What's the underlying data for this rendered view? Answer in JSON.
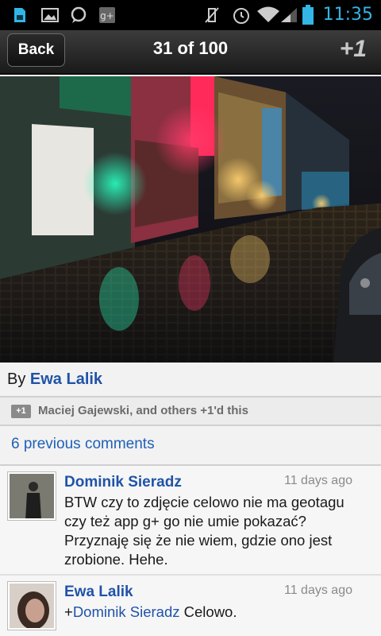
{
  "status_bar": {
    "time": "11:35",
    "icons": [
      "sim-card-icon",
      "gallery-icon",
      "talk-icon",
      "google-plus-icon",
      "vibrate-muted-icon",
      "alarm-icon",
      "wifi-icon",
      "signal-icon",
      "battery-icon"
    ],
    "time_color": "#33b5e5"
  },
  "header": {
    "back_label": "Back",
    "counter": "31 of 100",
    "plus_one_label": "+1"
  },
  "photo": {
    "description_icon": "photo-night-street"
  },
  "post": {
    "by_prefix": "By",
    "author": "Ewa Lalik",
    "plus_badge": "+1",
    "plus_text": "Maciej Gajewski, and others +1'd this",
    "previous_comments": "6 previous comments"
  },
  "comments": [
    {
      "author": "Dominik Sieradz",
      "time": "11 days ago",
      "text": "BTW czy to zdjęcie celowo nie ma geotagu czy też app g+ go nie umie pokazać? Przyznaję się że nie wiem, gdzie ono jest zrobione. Hehe."
    },
    {
      "author": "Ewa Lalik",
      "time": "11 days ago",
      "mention_prefix": "+",
      "mention": "Dominik Sieradz",
      "text": " Celowo."
    }
  ],
  "colors": {
    "link": "#2053a8",
    "accent": "#33b5e5"
  }
}
